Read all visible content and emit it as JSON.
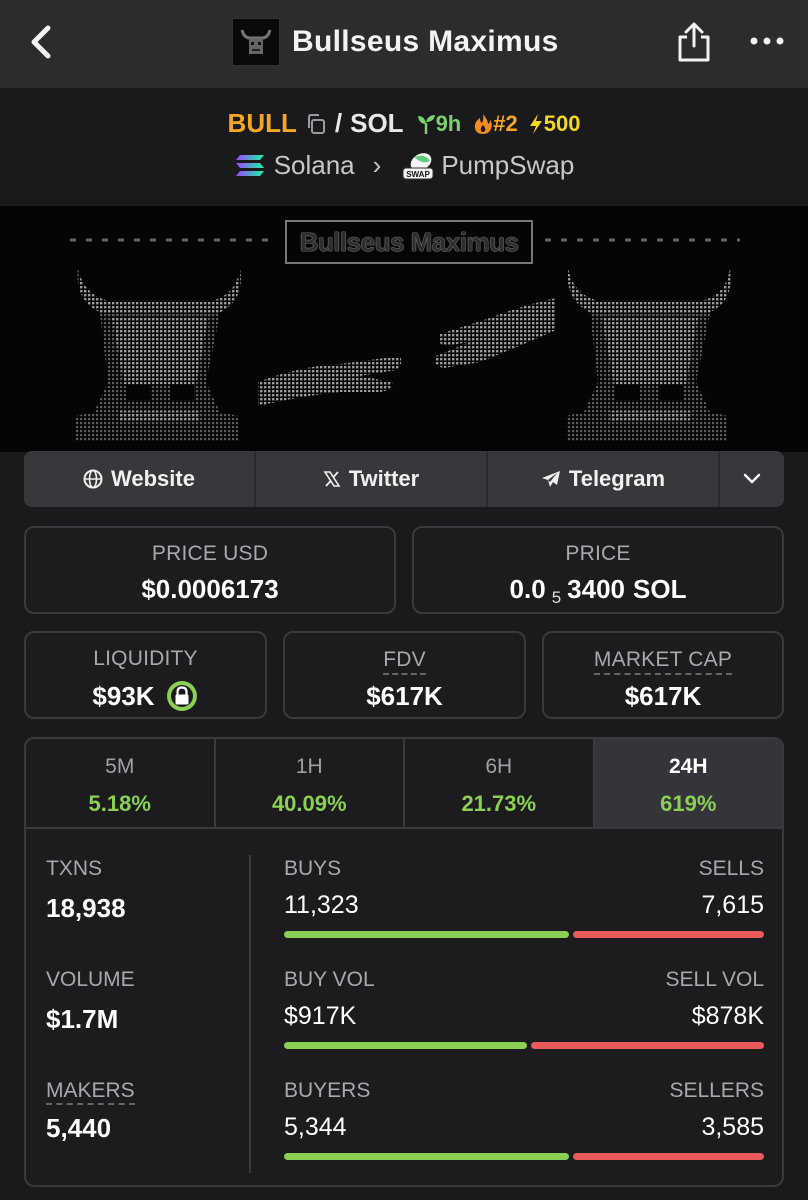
{
  "header": {
    "title": "Bullseus Maximus",
    "logo_text": "BULL"
  },
  "pair": {
    "base": "BULL",
    "slash": "/",
    "quote": "SOL",
    "age": "9h",
    "rank": "#2",
    "boost": "500",
    "chain": "Solana",
    "dex": "PumpSwap",
    "dex_badge": "SWAP"
  },
  "banner": {
    "title": "Bullseus Maximus"
  },
  "links": {
    "website": "Website",
    "twitter": "Twitter",
    "telegram": "Telegram"
  },
  "price_usd": {
    "label": "PRICE USD",
    "value": "$0.0006173"
  },
  "price_native": {
    "label": "PRICE",
    "prefix": "0.0",
    "zeros": "5",
    "digits": "3400",
    "unit": "SOL"
  },
  "liquidity": {
    "label": "LIQUIDITY",
    "value": "$93K"
  },
  "fdv": {
    "label": "FDV",
    "value": "$617K"
  },
  "market_cap": {
    "label": "MARKET CAP",
    "value": "$617K"
  },
  "tabs": [
    {
      "label": "5M",
      "change": "5.18%"
    },
    {
      "label": "1H",
      "change": "40.09%"
    },
    {
      "label": "6H",
      "change": "21.73%"
    },
    {
      "label": "24H",
      "change": "619%"
    }
  ],
  "left_stats": [
    {
      "label": "TXNS",
      "value": "18,938"
    },
    {
      "label": "VOLUME",
      "value": "$1.7M"
    },
    {
      "label": "MAKERS",
      "value": "5,440"
    }
  ],
  "split_stats": [
    {
      "left_label": "BUYS",
      "right_label": "SELLS",
      "left_value": "11,323",
      "right_value": "7,615",
      "left_share": 0.598
    },
    {
      "left_label": "BUY VOL",
      "right_label": "SELL VOL",
      "left_value": "$917K",
      "right_value": "$878K",
      "left_share": 0.511
    },
    {
      "left_label": "BUYERS",
      "right_label": "SELLERS",
      "left_value": "5,344",
      "right_value": "3,585",
      "left_share": 0.598
    }
  ],
  "colors": {
    "accent_orange": "#f5a623",
    "positive_green": "#8bd055",
    "negative_red": "#ea5a5a",
    "background": "#1a1a1d",
    "topbar": "#2c2c2f"
  }
}
